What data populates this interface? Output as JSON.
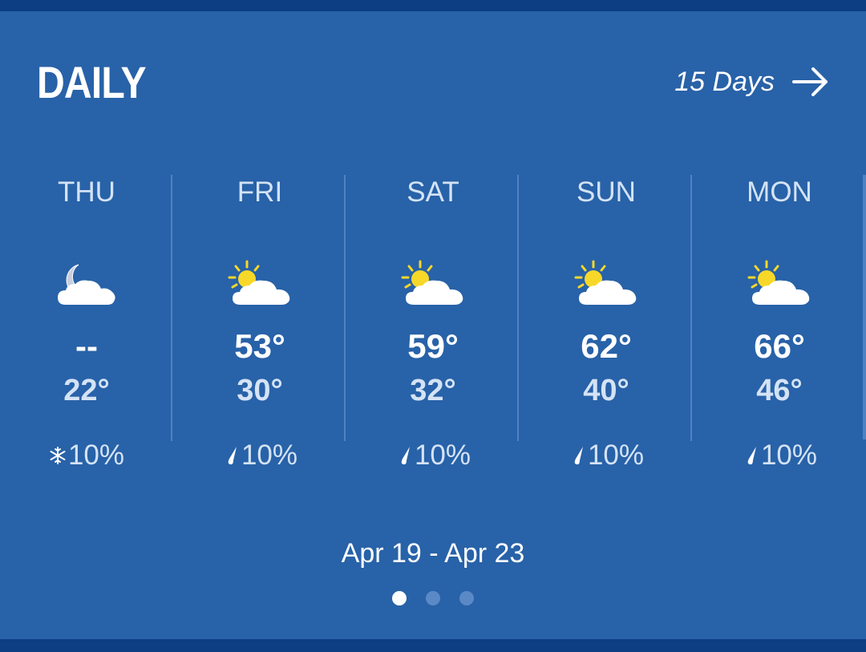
{
  "header": {
    "title": "DAILY",
    "more_label": "15 Days",
    "more_icon": "arrow-right-icon"
  },
  "days": [
    {
      "name": "THU",
      "icon": "night-moon-cloud-icon",
      "high": "--",
      "low": "22°",
      "precip_icon": "snowflake-icon",
      "precip": "10%"
    },
    {
      "name": "FRI",
      "icon": "partly-sunny-icon",
      "high": "53°",
      "low": "30°",
      "precip_icon": "raindrop-icon",
      "precip": "10%"
    },
    {
      "name": "SAT",
      "icon": "partly-sunny-icon",
      "high": "59°",
      "low": "32°",
      "precip_icon": "raindrop-icon",
      "precip": "10%"
    },
    {
      "name": "SUN",
      "icon": "partly-sunny-icon",
      "high": "62°",
      "low": "40°",
      "precip_icon": "raindrop-icon",
      "precip": "10%"
    },
    {
      "name": "MON",
      "icon": "partly-sunny-icon",
      "high": "66°",
      "low": "46°",
      "precip_icon": "raindrop-icon",
      "precip": "10%"
    }
  ],
  "date_range": "Apr 19 - Apr 23",
  "pagination": {
    "pages": 3,
    "current": 1
  },
  "colors": {
    "background": "#2862a8",
    "band": "#0d3d82",
    "sun": "#f7d829",
    "cloud": "#ffffff",
    "muted_text": "#d4e3f5"
  }
}
